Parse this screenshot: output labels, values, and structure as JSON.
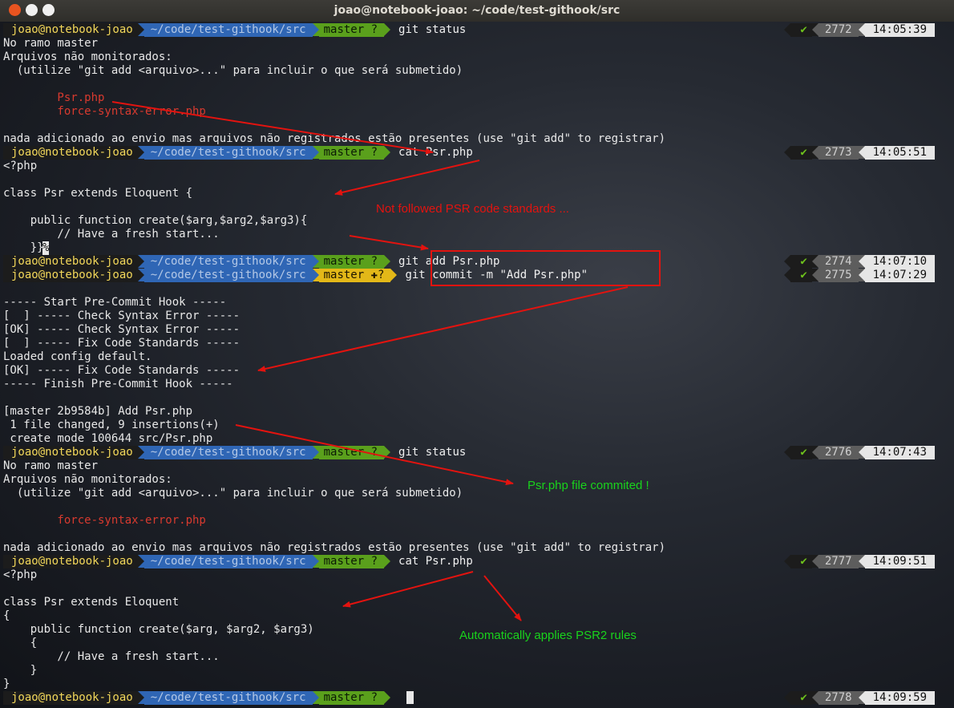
{
  "window": {
    "title": "joao@notebook-joao: ~/code/test-githook/src"
  },
  "prompt": {
    "user": "joao@notebook-joao",
    "path": "~/code/test-githook/src",
    "ok_glyph": "✔"
  },
  "colors": {
    "annotation_red": "#e3130f",
    "annotation_green": "#19d31c",
    "git_clean": "#5aa01c",
    "git_dirty": "#e3b818"
  },
  "prompts": [
    {
      "git": "master ?",
      "cmd": "git status",
      "hist": "2772",
      "time": "14:05:39"
    },
    {
      "git": "master ?",
      "cmd": "cat Psr.php",
      "hist": "2773",
      "time": "14:05:51"
    },
    {
      "git": "master ?",
      "cmd": "git add Psr.php",
      "hist": "2774",
      "time": "14:07:10"
    },
    {
      "git": "master ✚?",
      "cmd": "git commit -m \"Add Psr.php\"",
      "hist": "2775",
      "time": "14:07:29"
    },
    {
      "git": "master ?",
      "cmd": "git status",
      "hist": "2776",
      "time": "14:07:43"
    },
    {
      "git": "master ?",
      "cmd": "cat Psr.php",
      "hist": "2777",
      "time": "14:09:51"
    },
    {
      "git": "master ?",
      "cmd": "",
      "hist": "2778",
      "time": "14:09:59"
    }
  ],
  "output": {
    "status1": [
      "No ramo master",
      "Arquivos não monitorados:",
      "  (utilize \"git add <arquivo>...\" para incluir o que será submetido)",
      "",
      "        Psr.php",
      "        force-syntax-error.php",
      "",
      "nada adicionado ao envio mas arquivos não registrados estão presentes (use \"git add\" to registrar)"
    ],
    "cat1": [
      "<?php",
      "",
      "class Psr extends Eloquent {",
      "",
      "    public function create($arg,$arg2,$arg3){",
      "        // Have a fresh start...",
      "    }}"
    ],
    "cat1_eol_mark": "%",
    "hook": [
      "",
      "----- Start Pre-Commit Hook -----",
      "[  ] ----- Check Syntax Error -----",
      "[OK] ----- Check Syntax Error -----",
      "[  ] ----- Fix Code Standards -----",
      "Loaded config default.",
      "[OK] ----- Fix Code Standards -----",
      "----- Finish Pre-Commit Hook -----",
      "",
      "[master 2b9584b] Add Psr.php",
      " 1 file changed, 9 insertions(+)",
      " create mode 100644 src/Psr.php"
    ],
    "status2": [
      "No ramo master",
      "Arquivos não monitorados:",
      "  (utilize \"git add <arquivo>...\" para incluir o que será submetido)",
      "",
      "        force-syntax-error.php",
      "",
      "nada adicionado ao envio mas arquivos não registrados estão presentes (use \"git add\" to registrar)"
    ],
    "cat2": [
      "<?php",
      "",
      "class Psr extends Eloquent",
      "{",
      "    public function create($arg, $arg2, $arg3)",
      "    {",
      "        // Have a fresh start...",
      "    }",
      "}"
    ]
  },
  "annotations": {
    "not_followed": "Not followed PSR code standards ...",
    "committed": "Psr.php file commited !",
    "auto_applies": "Automatically applies PSR2 rules"
  }
}
